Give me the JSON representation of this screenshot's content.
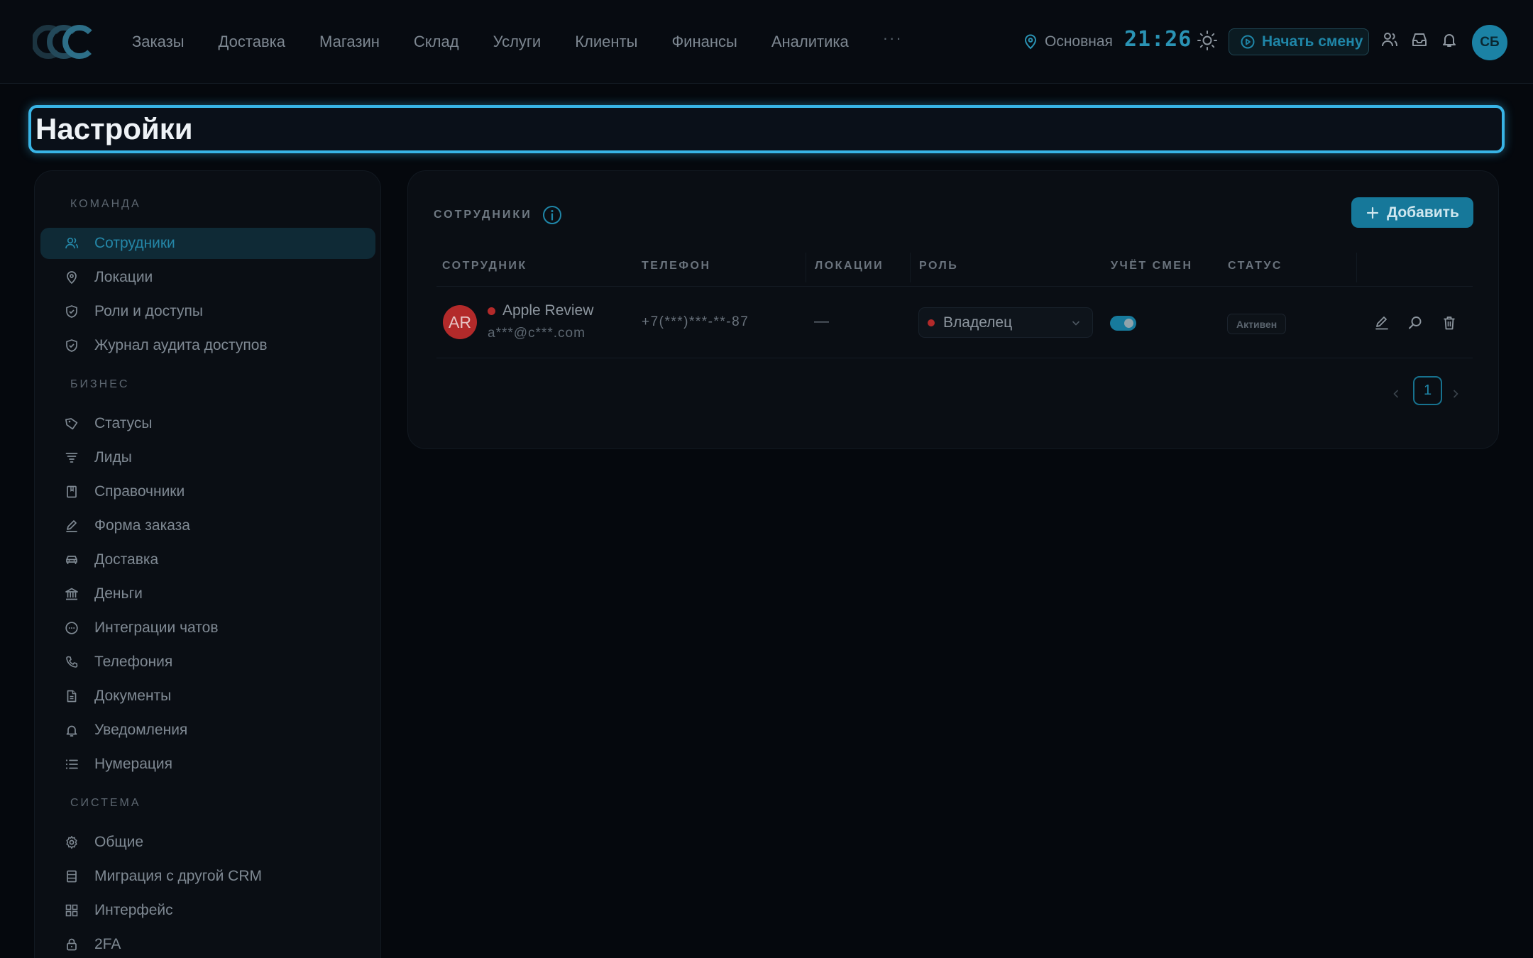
{
  "header": {
    "nav": [
      "Заказы",
      "Доставка",
      "Магазин",
      "Склад",
      "Услуги",
      "Клиенты",
      "Финансы",
      "Аналитика"
    ],
    "more": "···",
    "location": "Основная",
    "clock": "21:26",
    "start_shift": "Начать смену",
    "avatar_initials": "СБ"
  },
  "page": {
    "title": "Настройки"
  },
  "sidebar": {
    "sections": [
      {
        "title": "КОМАНДА",
        "items": [
          {
            "label": "Сотрудники",
            "icon": "users-icon",
            "active": true
          },
          {
            "label": "Локации",
            "icon": "map-pin-icon"
          },
          {
            "label": "Роли и доступы",
            "icon": "shield-icon"
          },
          {
            "label": "Журнал аудита доступов",
            "icon": "shield-check-icon"
          }
        ]
      },
      {
        "title": "БИЗНЕС",
        "items": [
          {
            "label": "Статусы",
            "icon": "tag-icon"
          },
          {
            "label": "Лиды",
            "icon": "funnel-icon"
          },
          {
            "label": "Справочники",
            "icon": "book-icon"
          },
          {
            "label": "Форма заказа",
            "icon": "pen-icon"
          },
          {
            "label": "Доставка",
            "icon": "car-icon"
          },
          {
            "label": "Деньги",
            "icon": "bank-icon"
          },
          {
            "label": "Интеграции чатов",
            "icon": "chat-icon"
          },
          {
            "label": "Телефония",
            "icon": "phone-icon"
          },
          {
            "label": "Документы",
            "icon": "document-icon"
          },
          {
            "label": "Уведомления",
            "icon": "bell-icon"
          },
          {
            "label": "Нумерация",
            "icon": "list-icon"
          }
        ]
      },
      {
        "title": "СИСТЕМА",
        "items": [
          {
            "label": "Общие",
            "icon": "gear-icon"
          },
          {
            "label": "Миграция с другой CRM",
            "icon": "database-icon"
          },
          {
            "label": "Интерфейс",
            "icon": "grid-icon"
          },
          {
            "label": "2FA",
            "icon": "lock-icon"
          }
        ]
      }
    ]
  },
  "employees": {
    "title": "СОТРУДНИКИ",
    "add_button": "Добавить",
    "columns": [
      "СОТРУДНИК",
      "ТЕЛЕФОН",
      "ЛОКАЦИИ",
      "РОЛЬ",
      "УЧЁТ СМЕН",
      "СТАТУС"
    ],
    "rows": [
      {
        "initials": "AR",
        "name": "Apple Review",
        "email": "a***@c***.com",
        "phone": "+7(***)***-**-87",
        "locations": "—",
        "role": "Владелец",
        "shift_tracking": true,
        "status": "Активен"
      }
    ],
    "pagination": {
      "current": "1"
    }
  },
  "colors": {
    "accent": "#38b4e6",
    "brand": "#16789a",
    "danger_dot": "#b32a2a",
    "background": "#05080d"
  }
}
